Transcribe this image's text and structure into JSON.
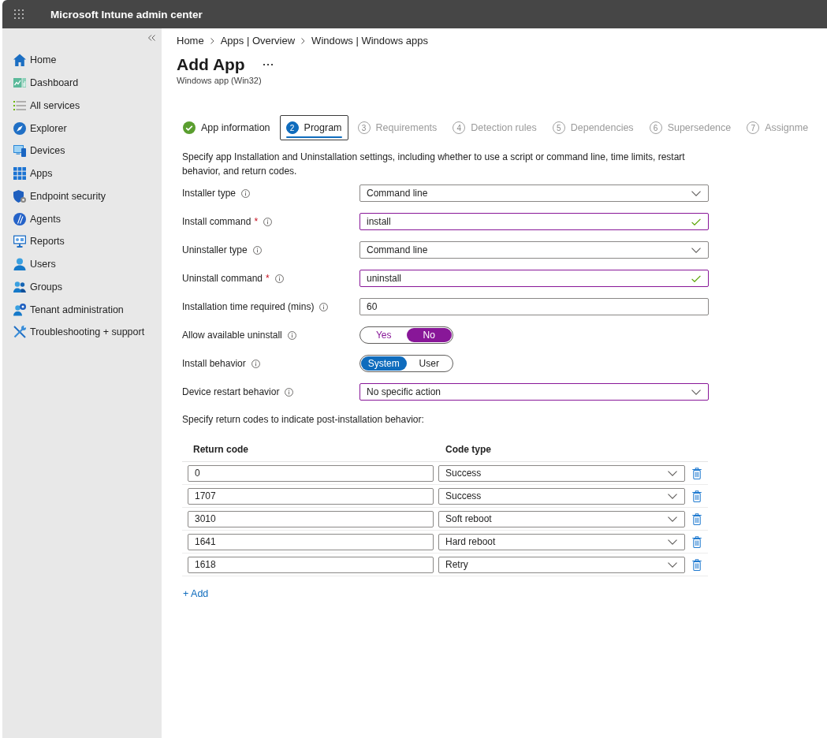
{
  "top_bar": {
    "title": "Microsoft Intune admin center"
  },
  "sidebar": {
    "items": [
      {
        "label": "Home",
        "selected": false
      },
      {
        "label": "Dashboard",
        "selected": false
      },
      {
        "label": "All services",
        "selected": false
      },
      {
        "label": "Explorer",
        "selected": false
      },
      {
        "label": "Devices",
        "selected": false
      },
      {
        "label": "Apps",
        "selected": false
      },
      {
        "label": "Endpoint security",
        "selected": false
      },
      {
        "label": "Agents",
        "selected": false
      },
      {
        "label": "Reports",
        "selected": false
      },
      {
        "label": "Users",
        "selected": false
      },
      {
        "label": "Groups",
        "selected": false
      },
      {
        "label": "Tenant administration",
        "selected": false
      },
      {
        "label": "Troubleshooting + support",
        "selected": false
      }
    ]
  },
  "breadcrumb": [
    "Home",
    "Apps | Overview",
    "Windows | Windows apps"
  ],
  "page": {
    "title": "Add App",
    "subtitle": "Windows app (Win32)"
  },
  "tabs": [
    {
      "label": "App information",
      "selected": false,
      "completed": true,
      "disabled": false
    },
    {
      "number": "2",
      "label": "Program",
      "selected": true,
      "completed": false,
      "disabled": false
    },
    {
      "number": "3",
      "label": "Requirements",
      "selected": false,
      "completed": false,
      "disabled": true
    },
    {
      "number": "4",
      "label": "Detection rules",
      "selected": false,
      "completed": false,
      "disabled": true
    },
    {
      "number": "5",
      "label": "Dependencies",
      "selected": false,
      "completed": false,
      "disabled": true
    },
    {
      "number": "6",
      "label": "Supersedence",
      "selected": false,
      "completed": false,
      "disabled": true
    },
    {
      "number": "7",
      "label": "Assignme",
      "selected": false,
      "completed": false,
      "disabled": true
    }
  ],
  "form": {
    "description": "Specify app Installation and Uninstallation settings, including whether to use a script or command line, time limits, restart behavior, and return codes.",
    "fields": [
      {
        "kind": "dropdown",
        "label": "Installer type",
        "info": true,
        "value": "Command line",
        "modified": false
      },
      {
        "kind": "text",
        "label": "Install command",
        "required_mark": "*",
        "info": true,
        "value": "install",
        "modified": true,
        "valid": true
      },
      {
        "kind": "dropdown",
        "label": "Uninstaller type",
        "info": true,
        "value": "Command line",
        "modified": false
      },
      {
        "kind": "text",
        "label": "Uninstall command",
        "required_mark": "*",
        "info": true,
        "value": "uninstall",
        "modified": true,
        "valid": true
      },
      {
        "kind": "text",
        "label": "Installation time required (mins)",
        "info": true,
        "value": "60",
        "modified": false,
        "valid": false
      },
      {
        "kind": "toggle",
        "label": "Allow available uninstall",
        "info": true,
        "modified": true,
        "options": [
          {
            "label": "Yes",
            "selected": false
          },
          {
            "label": "No",
            "selected": true
          }
        ]
      },
      {
        "kind": "toggle",
        "label": "Install behavior",
        "info": true,
        "modified": false,
        "options": [
          {
            "label": "System",
            "selected": true
          },
          {
            "label": "User",
            "selected": false
          }
        ]
      },
      {
        "kind": "dropdown",
        "label": "Device restart behavior",
        "info": true,
        "value": "No specific action",
        "modified": true
      }
    ]
  },
  "return_codes": {
    "intro": "Specify return codes to indicate post-installation behavior:",
    "columns": [
      "Return code",
      "Code type"
    ],
    "rows": [
      {
        "code": "0",
        "type": "Success"
      },
      {
        "code": "1707",
        "type": "Success"
      },
      {
        "code": "3010",
        "type": "Soft reboot"
      },
      {
        "code": "1641",
        "type": "Hard reboot"
      },
      {
        "code": "1618",
        "type": "Retry"
      }
    ],
    "add_link": "+ Add"
  }
}
